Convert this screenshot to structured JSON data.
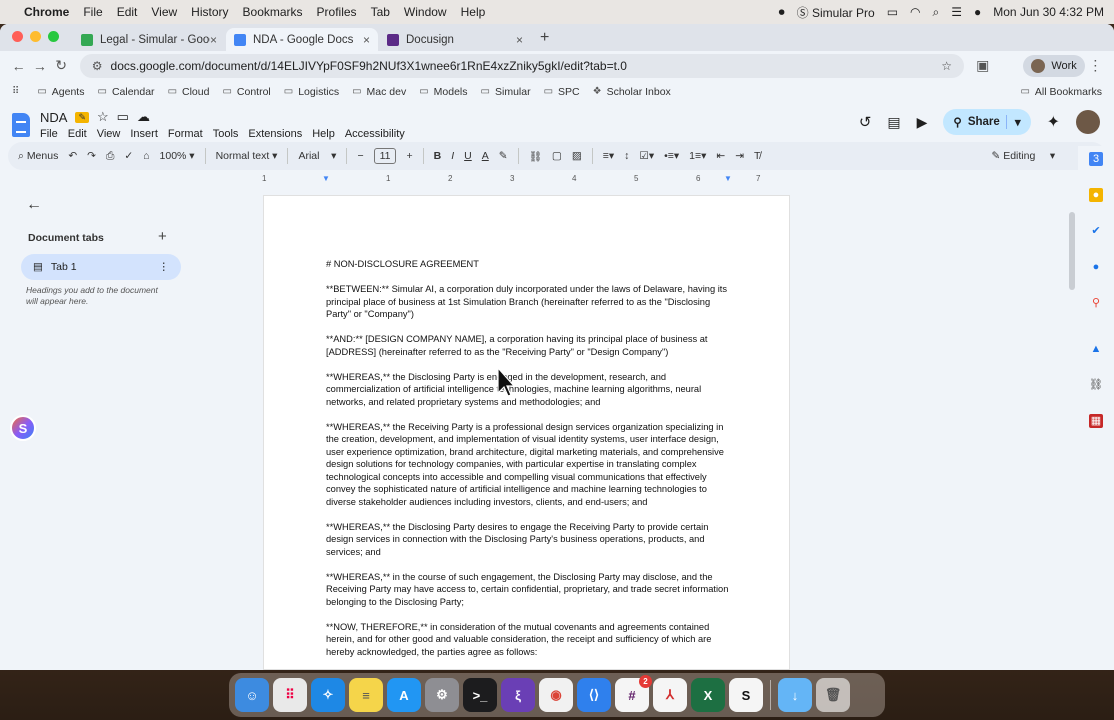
{
  "menubar": {
    "app": "Chrome",
    "items": [
      "File",
      "Edit",
      "View",
      "History",
      "Bookmarks",
      "Profiles",
      "Tab",
      "Window",
      "Help"
    ],
    "simular": "Simular Pro",
    "clock": "Mon Jun 30  4:32 PM"
  },
  "tabs": [
    {
      "title": "Legal - Simular - Google Driv",
      "color": "#34a853"
    },
    {
      "title": "NDA - Google Docs",
      "color": "#4285f4"
    },
    {
      "title": "Docusign",
      "color": "#5b2a86"
    }
  ],
  "address": {
    "url": "docs.google.com/document/d/14ELJIVYpF0SF9h2NUf3X1wnee6r1RnE4xzZniky5gkI/edit?tab=t.0",
    "profile": "Work"
  },
  "bookmarks": [
    "Agents",
    "Calendar",
    "Cloud",
    "Control",
    "Logistics",
    "Mac dev",
    "Models",
    "Simular",
    "SPC",
    "Scholar Inbox"
  ],
  "all_bookmarks": "All Bookmarks",
  "docs": {
    "title": "NDA",
    "menus": [
      "File",
      "Edit",
      "View",
      "Insert",
      "Format",
      "Tools",
      "Extensions",
      "Help",
      "Accessibility"
    ],
    "share": "Share"
  },
  "toolbar": {
    "menus": "Menus",
    "zoom": "100%",
    "style": "Normal text",
    "font": "Arial",
    "size": "11",
    "mode": "Editing"
  },
  "ruler": [
    "1",
    "1",
    "2",
    "3",
    "4",
    "5",
    "6",
    "7"
  ],
  "sidebar": {
    "heading": "Document tabs",
    "tab": "Tab 1",
    "hint": "Headings you add to the document will appear here."
  },
  "document": {
    "paragraphs": [
      "# NON-DISCLOSURE AGREEMENT",
      "**BETWEEN:** Simular AI, a corporation duly incorporated under the laws of Delaware, having its principal place of business at 1st Simulation Branch (hereinafter referred to as the \"Disclosing Party\" or \"Company\")",
      "**AND:** [DESIGN COMPANY NAME], a corporation having its principal place of business at [ADDRESS] (hereinafter referred to as the \"Receiving Party\" or \"Design Company\")",
      "**WHEREAS,** the Disclosing Party is engaged in the development, research, and commercialization of artificial intelligence technologies, machine learning algorithms, neural networks, and related proprietary systems and methodologies; and",
      "**WHEREAS,** the Receiving Party is a professional design services organization specializing in the creation, development, and implementation of visual identity systems, user interface design, user experience optimization, brand architecture, digital marketing materials, and comprehensive design solutions for technology companies, with particular expertise in translating complex technological concepts into accessible and compelling visual communications that effectively convey the sophisticated nature of artificial intelligence and machine learning technologies to diverse stakeholder audiences including investors, clients, and end-users; and",
      "**WHEREAS,** the Disclosing Party desires to engage the Receiving Party to provide certain design services in connection with the Disclosing Party's business operations, products, and services; and",
      "**WHEREAS,** in the course of such engagement, the Disclosing Party may disclose, and the Receiving Party may have access to, certain confidential, proprietary, and trade secret information belonging to the Disclosing Party;",
      "**NOW, THEREFORE,** in consideration of the mutual covenants and agreements contained herein, and for other good and valuable consideration, the receipt and sufficiency of which are hereby acknowledged, the parties agree as follows:"
    ]
  },
  "dock": {
    "slack_badge": "2"
  }
}
